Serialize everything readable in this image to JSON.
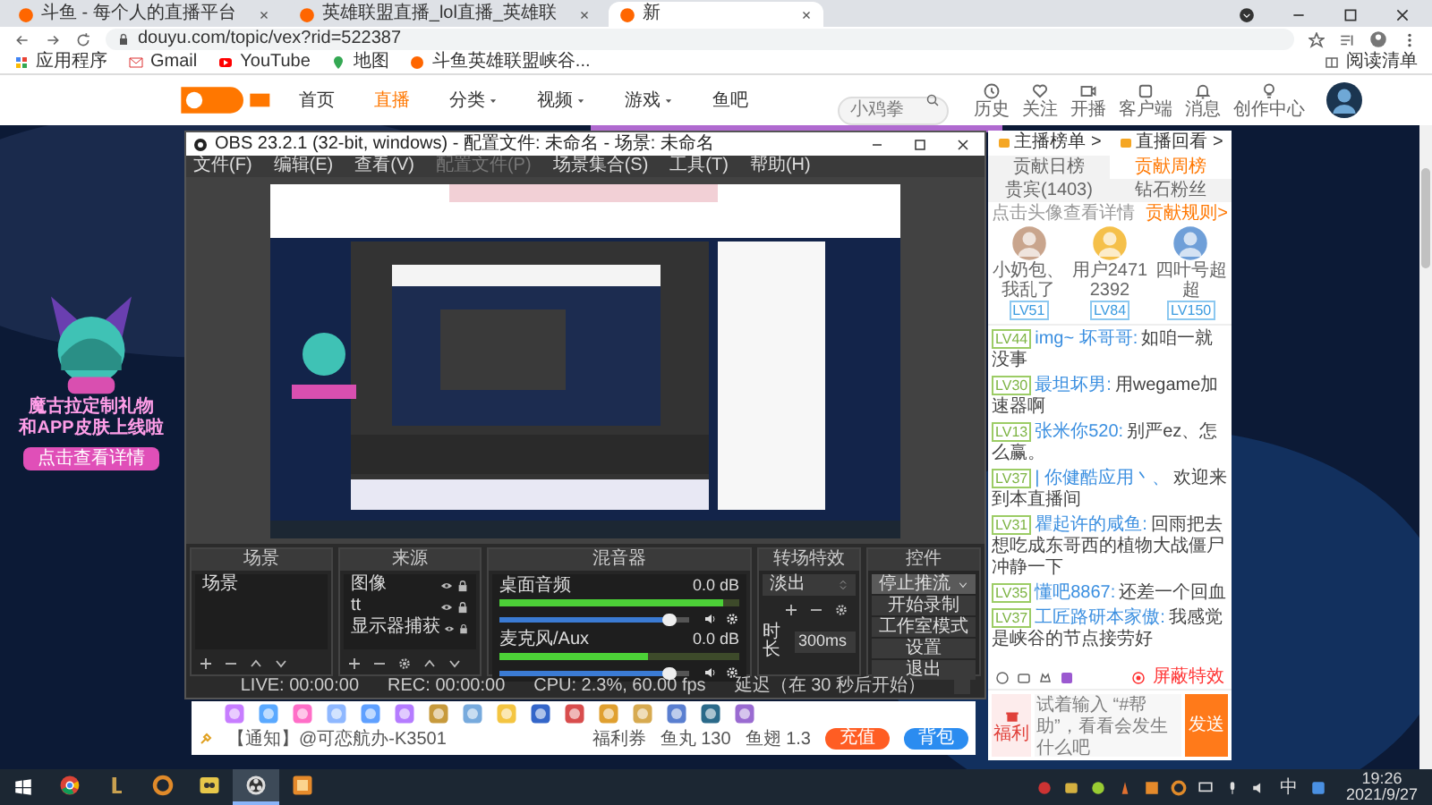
{
  "browser": {
    "tabs": [
      {
        "label": "斗鱼 - 每个人的直播平台",
        "selected": false
      },
      {
        "label": "英雄联盟直播_lol直播_英雄联",
        "selected": false
      },
      {
        "label": "新",
        "selected": true
      }
    ],
    "address": "douyu.com/topic/vex?rid=522387",
    "bookmarks": [
      "应用程序",
      "Gmail",
      "YouTube",
      "地图",
      "斗鱼英雄联盟峡谷..."
    ],
    "reading_list": "阅读清单"
  },
  "site_header": {
    "nav": [
      {
        "label": "首页",
        "selected": false,
        "dropdown": false
      },
      {
        "label": "直播",
        "selected": true,
        "dropdown": false
      },
      {
        "label": "分类",
        "selected": false,
        "dropdown": true
      },
      {
        "label": "视频",
        "selected": false,
        "dropdown": true
      },
      {
        "label": "游戏",
        "selected": false,
        "dropdown": true
      },
      {
        "label": "鱼吧",
        "selected": false,
        "dropdown": false
      }
    ],
    "search": {
      "placeholder": "小鸡拳"
    },
    "icons": [
      {
        "label": "历史",
        "kind": "clock"
      },
      {
        "label": "关注",
        "kind": "heart"
      },
      {
        "label": "开播",
        "kind": "camera"
      },
      {
        "label": "客户端",
        "kind": "box"
      },
      {
        "label": "消息",
        "kind": "bell"
      },
      {
        "label": "创作中心",
        "kind": "bulb"
      }
    ]
  },
  "promo": {
    "lines": [
      "魔古拉定制礼物",
      "和APP皮肤上线啦"
    ],
    "button": "点击查看详情"
  },
  "obs": {
    "title": "OBS 23.2.1 (32-bit, windows) - 配置文件: 未命名 - 场景: 未命名",
    "menu": [
      {
        "label": "文件(F)",
        "disabled": false
      },
      {
        "label": "编辑(E)",
        "disabled": false
      },
      {
        "label": "查看(V)",
        "disabled": false
      },
      {
        "label": "配置文件(P)",
        "disabled": true
      },
      {
        "label": "场景集合(S)",
        "disabled": false
      },
      {
        "label": "工具(T)",
        "disabled": false
      },
      {
        "label": "帮助(H)",
        "disabled": false
      }
    ],
    "scenes": {
      "title": "场景",
      "items": [
        "场景"
      ]
    },
    "sources": {
      "title": "来源",
      "items": [
        "图像",
        "tt",
        "显示器捕获"
      ]
    },
    "mixer": {
      "title": "混音器",
      "channels": [
        {
          "name": "桌面音频",
          "reading": "0.0 dB",
          "meter": {
            "level": 0.93
          },
          "volume": {
            "level": 0.9
          }
        },
        {
          "name": "麦克风/Aux",
          "reading": "0.0 dB",
          "meter": {
            "level": 0.62
          },
          "volume": {
            "level": 0.9
          }
        }
      ]
    },
    "transitions": {
      "title": "转场特效",
      "transition": "淡出",
      "duration_label": "时长",
      "duration": "300ms"
    },
    "controls": {
      "title": "控件",
      "buttons": [
        {
          "label": "停止推流",
          "kind": "split"
        },
        {
          "label": "开始录制",
          "kind": "plain"
        },
        {
          "label": "工作室模式",
          "kind": "plain"
        },
        {
          "label": "设置",
          "kind": "plain"
        },
        {
          "label": "退出",
          "kind": "plain"
        }
      ]
    },
    "status": [
      "LIVE: 00:00:00",
      "REC: 00:00:00",
      "CPU: 2.3%, 60.00 fps",
      "延迟（在 30 秒后开始）"
    ]
  },
  "gift_bar": {
    "notice": "【通知】@可恋航办-K3501",
    "welfare": "福利券",
    "fish_balls": "鱼丸 130",
    "fish_fins": "鱼翅 1.3",
    "recharge": "充值",
    "backpack": "背包"
  },
  "chat": {
    "links": [
      "主播榜单 >",
      "直播回看 >"
    ],
    "tabs": [
      {
        "label": "贡献日榜",
        "selected": false
      },
      {
        "label": "贡献周榜",
        "selected": true
      },
      {
        "label": "贵宾(1403)",
        "selected": false
      },
      {
        "label": "钻石粉丝",
        "selected": false
      }
    ],
    "hint": "点击头像查看详情",
    "rules": "贡献规则>",
    "top_fans": [
      {
        "name": "小奶包、我乱了",
        "level": "LV51"
      },
      {
        "name": "用户24712392",
        "level": "LV84"
      },
      {
        "name": "四叶号超超",
        "level": "LV150"
      }
    ],
    "messages": [
      {
        "level": "LV44",
        "user": "img~ 坏哥哥:",
        "text": "如咱一就没事"
      },
      {
        "level": "LV30",
        "user": "最坦坏男:",
        "text": "用wegame加速器啊"
      },
      {
        "level": "LV13",
        "user": "张米你520:",
        "text": "别严ez、怎么赢。"
      },
      {
        "level": "LV37",
        "user": "| 你健酷应用丶、",
        "text": "欢迎来到本直播间"
      },
      {
        "level": "LV31",
        "user": "瞿起许的咸鱼:",
        "text": "回雨把去想吃成东哥西的植物大战僵尸冲静一下"
      },
      {
        "level": "LV35",
        "user": "懂吧8867:",
        "text": "还差一个回血"
      },
      {
        "level": "LV37",
        "user": "工匠路研本家傲:",
        "text": "我感觉是峡谷的节点接劳好"
      }
    ],
    "shield": "屏蔽特效",
    "welfare_badge": "福利",
    "input": {
      "placeholder": "试着输入 “#帮助”，看看会发生什么吧"
    },
    "send": "发送"
  },
  "taskbar": {
    "apps": [
      {
        "kind": "chrome",
        "selected": false
      },
      {
        "kind": "gold",
        "selected": false
      },
      {
        "kind": "orange",
        "selected": false
      },
      {
        "kind": "yellow",
        "selected": false
      },
      {
        "kind": "obs",
        "selected": true
      },
      {
        "kind": "square",
        "selected": false
      }
    ],
    "ime": "中",
    "time": "19:26",
    "date": "2021/9/27"
  }
}
